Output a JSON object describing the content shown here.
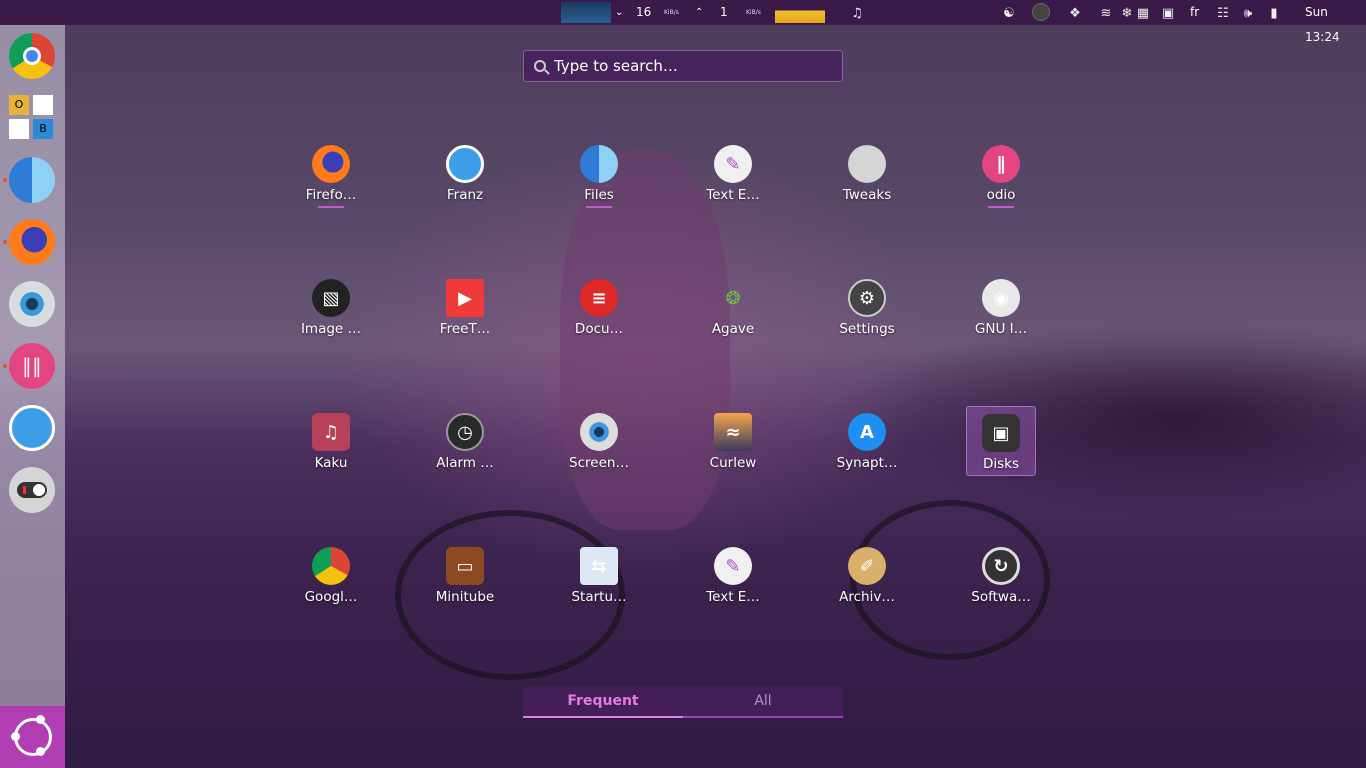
{
  "panel": {
    "download_value": "16",
    "download_unit": "KiB/s",
    "upload_value": "1",
    "upload_unit": "KiB/s",
    "keyboard_layout": "fr",
    "clock": "Sun 13:24"
  },
  "search": {
    "placeholder": "Type to search…"
  },
  "apps": [
    {
      "label": "Firefo…",
      "icon": "firefox-icon",
      "running": true
    },
    {
      "label": "Franz",
      "icon": "franz-icon",
      "running": false
    },
    {
      "label": "Files",
      "icon": "files-icon",
      "running": true
    },
    {
      "label": "Text E…",
      "icon": "text-editor-icon",
      "running": false
    },
    {
      "label": "Tweaks",
      "icon": "tweaks-icon",
      "running": false
    },
    {
      "label": "odio",
      "icon": "odio-icon",
      "running": true
    },
    {
      "label": "Image …",
      "icon": "image-viewer-icon",
      "running": false
    },
    {
      "label": "FreeT…",
      "icon": "freetube-icon",
      "running": false
    },
    {
      "label": "Docu…",
      "icon": "document-viewer-icon",
      "running": false
    },
    {
      "label": "Agave",
      "icon": "agave-icon",
      "running": false
    },
    {
      "label": "Settings",
      "icon": "settings-icon",
      "running": false
    },
    {
      "label": "GNU I…",
      "icon": "gimp-icon",
      "running": false
    },
    {
      "label": "Kaku",
      "icon": "kaku-icon",
      "running": false
    },
    {
      "label": "Alarm …",
      "icon": "alarm-clock-icon",
      "running": false
    },
    {
      "label": "Screen…",
      "icon": "screenshot-icon",
      "running": false
    },
    {
      "label": "Curlew",
      "icon": "curlew-icon",
      "running": false
    },
    {
      "label": "Synapt…",
      "icon": "synaptic-icon",
      "running": false
    },
    {
      "label": "Disks",
      "icon": "disks-icon",
      "running": false
    },
    {
      "label": "Googl…",
      "icon": "chrome-icon",
      "running": false
    },
    {
      "label": "Minitube",
      "icon": "minitube-icon",
      "running": false
    },
    {
      "label": "Startu…",
      "icon": "startup-apps-icon",
      "running": false
    },
    {
      "label": "Text E…",
      "icon": "text-editor-icon",
      "running": false
    },
    {
      "label": "Archiv…",
      "icon": "archive-manager-icon",
      "running": false
    },
    {
      "label": "Softwa…",
      "icon": "software-updater-icon",
      "running": false
    }
  ],
  "launcher": [
    {
      "icon": "chrome-icon",
      "running": false
    },
    {
      "icon": "libreoffice-icon",
      "running": false,
      "glyphs": [
        "O",
        "B"
      ]
    },
    {
      "icon": "files-icon",
      "running": true
    },
    {
      "icon": "firefox-icon",
      "running": true
    },
    {
      "icon": "screenshot-icon",
      "running": false
    },
    {
      "icon": "odio-icon",
      "running": true
    },
    {
      "icon": "franz-icon",
      "running": false
    },
    {
      "icon": "tweaks-icon",
      "running": false
    }
  ],
  "tabs": {
    "frequent": "Frequent",
    "all": "All"
  },
  "colors": {
    "accent": "#b23eb4",
    "panel": "#3a1a48",
    "tab_active": "#e47ae8"
  }
}
